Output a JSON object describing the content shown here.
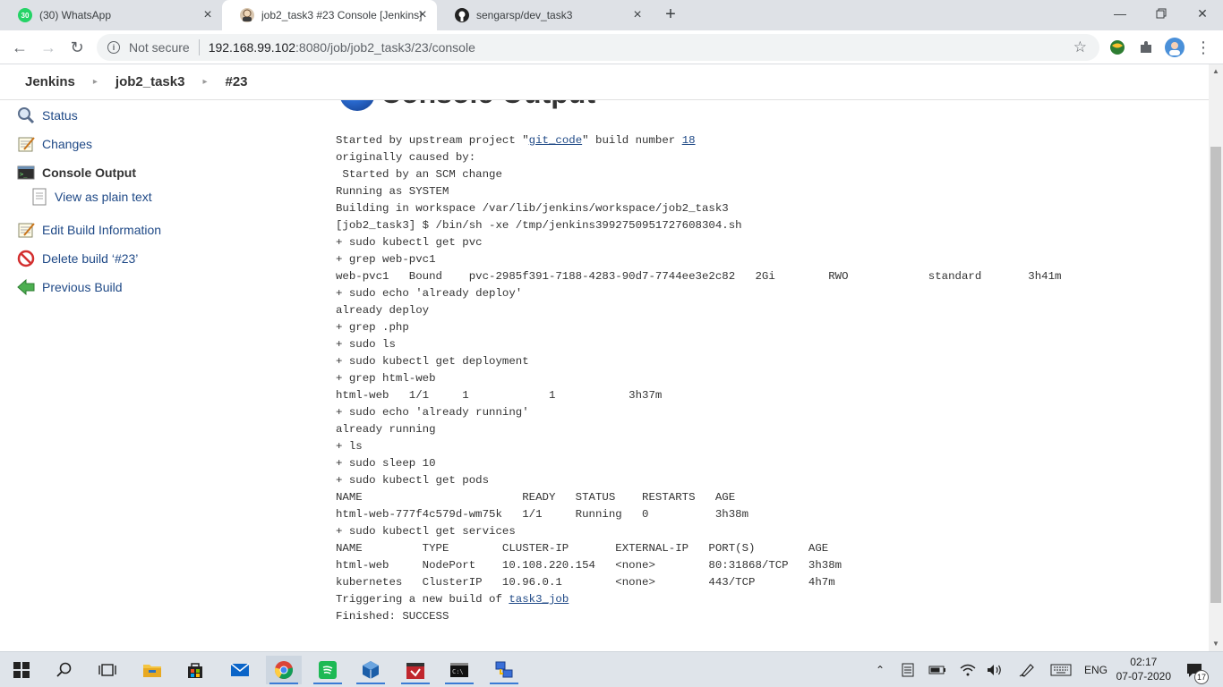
{
  "browser": {
    "tabs": [
      {
        "title": "(30) WhatsApp",
        "favicon_text": "30",
        "favicon_color": "#25d366",
        "active": false
      },
      {
        "title": "job2_task3 #23 Console [Jenkins]",
        "active": true
      },
      {
        "title": "sengarsp/dev_task3",
        "active": false
      }
    ],
    "security_label": "Not secure",
    "url_host": "192.168.99.102",
    "url_path": ":8080/job/job2_task3/23/console"
  },
  "breadcrumb": {
    "items": [
      "Jenkins",
      "job2_task3",
      "#23"
    ]
  },
  "sidebar": {
    "status": "Status",
    "changes": "Changes",
    "console_output": "Console Output",
    "view_plain": "View as plain text",
    "edit_build": "Edit Build Information",
    "delete_build": "Delete build ‘#23’",
    "previous_build": "Previous Build"
  },
  "main": {
    "title": "Console Output",
    "console": {
      "started_prefix": "Started by upstream project \"",
      "upstream_project": "git_code",
      "started_middle": "\" build number ",
      "build_number": "18",
      "body": "originally caused by:\n Started by an SCM change\nRunning as SYSTEM\nBuilding in workspace /var/lib/jenkins/workspace/job2_task3\n[job2_task3] $ /bin/sh -xe /tmp/jenkins3992750951727608304.sh\n+ sudo kubectl get pvc\n+ grep web-pvc1\nweb-pvc1   Bound    pvc-2985f391-7188-4283-90d7-7744ee3e2c82   2Gi        RWO            standard       3h41m\n+ sudo echo 'already deploy'\nalready deploy\n+ grep .php\n+ sudo ls\n+ sudo kubectl get deployment\n+ grep html-web\nhtml-web   1/1     1            1           3h37m\n+ sudo echo 'already running'\nalready running\n+ ls\n+ sudo sleep 10\n+ sudo kubectl get pods\nNAME                        READY   STATUS    RESTARTS   AGE\nhtml-web-777f4c579d-wm75k   1/1     Running   0          3h38m\n+ sudo kubectl get services\nNAME         TYPE        CLUSTER-IP       EXTERNAL-IP   PORT(S)        AGE\nhtml-web     NodePort    10.108.220.154   <none>        80:31868/TCP   3h38m\nkubernetes   ClusterIP   10.96.0.1        <none>        443/TCP        4h7m",
      "trigger_prefix": "Triggering a new build of ",
      "triggered_job": "task3_job",
      "finished": "Finished: SUCCESS"
    }
  },
  "taskbar": {
    "language": "ENG",
    "time": "02:17",
    "date": "07-07-2020",
    "notification_count": "17"
  }
}
